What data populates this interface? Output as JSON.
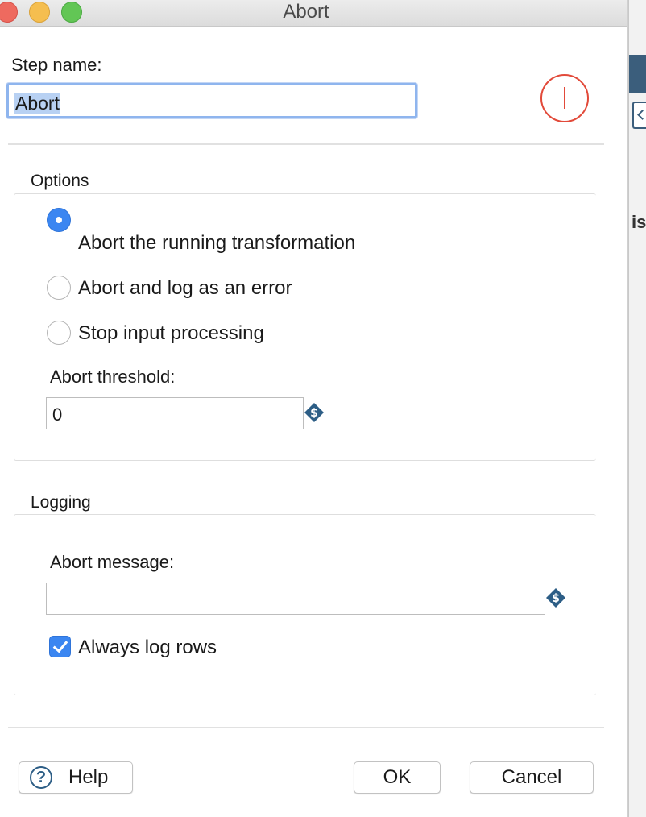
{
  "window": {
    "title": "Abort"
  },
  "step": {
    "label": "Step name:",
    "value": "Abort"
  },
  "options": {
    "legend": "Options",
    "radios": [
      {
        "label": "Abort the running transformation",
        "checked": true
      },
      {
        "label": "Abort and log as an error",
        "checked": false
      },
      {
        "label": "Stop input processing",
        "checked": false
      }
    ],
    "threshold_label": "Abort threshold:",
    "threshold_value": "0"
  },
  "logging": {
    "legend": "Logging",
    "message_label": "Abort message:",
    "message_value": "",
    "always_log_label": "Always log rows",
    "always_log_checked": true
  },
  "buttons": {
    "help": "Help",
    "ok": "OK",
    "cancel": "Cancel"
  },
  "background_app": {
    "text_fragment": "is"
  },
  "colors": {
    "accent": "#3b86f1",
    "abort_icon": "#e24a3a",
    "variable_icon": "#2d5e86"
  },
  "icons": {
    "step_icon": "abort-icon",
    "variable": "variable-dollar-icon",
    "help": "help-icon"
  }
}
